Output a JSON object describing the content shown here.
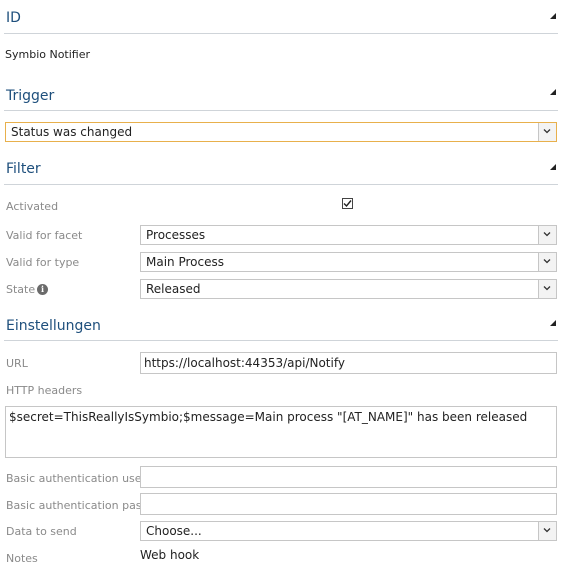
{
  "sections": {
    "id": {
      "title": "ID",
      "value": "Symbio Notifier"
    },
    "trigger": {
      "title": "Trigger",
      "value": "Status was changed"
    },
    "filter": {
      "title": "Filter",
      "activated_label": "Activated",
      "activated_checked": true,
      "facet_label": "Valid for facet",
      "facet_value": "Processes",
      "type_label": "Valid for type",
      "type_value": "Main Process",
      "state_label": "State",
      "state_value": "Released"
    },
    "settings": {
      "title": "Einstellungen",
      "url_label": "URL",
      "url_value": "https://localhost:44353/api/Notify",
      "headers_label": "HTTP headers",
      "headers_value": "$secret=ThisReallyIsSymbio;$message=Main process \"[AT_NAME]\" has been released",
      "basic_user_label": "Basic authentication user...",
      "basic_user_value": "",
      "basic_pass_label": "Basic authentication pas...",
      "basic_pass_value": "",
      "data_label": "Data to send",
      "data_value": "Choose...",
      "notes_label": "Notes",
      "notes_value": "Web hook"
    }
  },
  "colors": {
    "section_title": "#1e4f7c",
    "trigger_border": "#e8b04c",
    "divider": "#cfd4d9"
  },
  "icons": [
    "collapse-icon",
    "chevron-down-icon",
    "checkmark-icon",
    "info-icon"
  ]
}
